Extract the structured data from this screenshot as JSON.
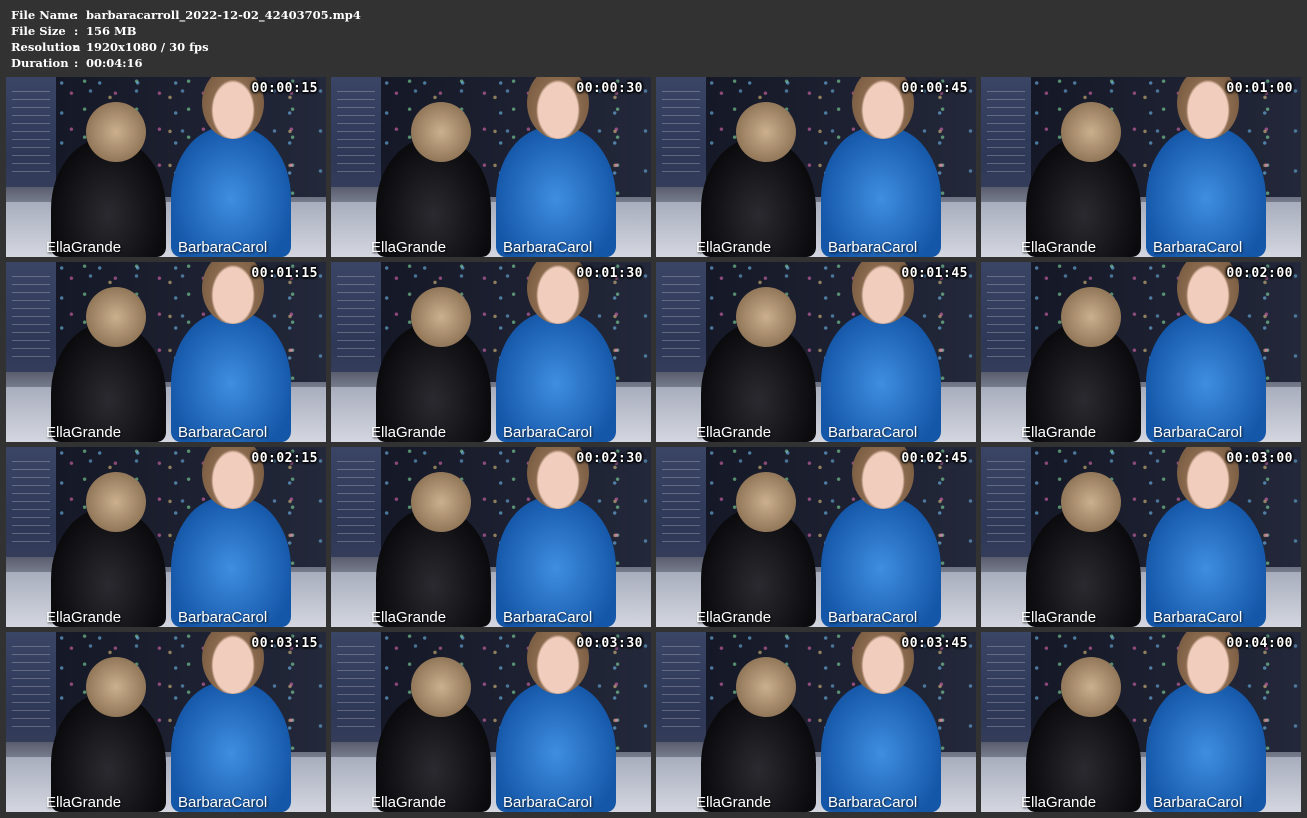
{
  "meta": [
    {
      "key": "File Name",
      "sep": ":",
      "value": "barbaracarroll_2022-12-02_42403705.mp4"
    },
    {
      "key": "File Size",
      "sep": ":",
      "value": "156 MB"
    },
    {
      "key": "Resolution",
      "sep": ":",
      "value": "1920x1080 / 30 fps"
    },
    {
      "key": "Duration",
      "sep": ":",
      "value": "00:04:16"
    }
  ],
  "thumbnails": [
    {
      "timestamp": "00:00:15",
      "left_name": "EllaGrande",
      "right_name": "BarbaraCarol"
    },
    {
      "timestamp": "00:00:30",
      "left_name": "EllaGrande",
      "right_name": "BarbaraCarol"
    },
    {
      "timestamp": "00:00:45",
      "left_name": "EllaGrande",
      "right_name": "BarbaraCarol"
    },
    {
      "timestamp": "00:01:00",
      "left_name": "EllaGrande",
      "right_name": "BarbaraCarol"
    },
    {
      "timestamp": "00:01:15",
      "left_name": "EllaGrande",
      "right_name": "BarbaraCarol"
    },
    {
      "timestamp": "00:01:30",
      "left_name": "EllaGrande",
      "right_name": "BarbaraCarol"
    },
    {
      "timestamp": "00:01:45",
      "left_name": "EllaGrande",
      "right_name": "BarbaraCarol"
    },
    {
      "timestamp": "00:02:00",
      "left_name": "EllaGrande",
      "right_name": "BarbaraCarol"
    },
    {
      "timestamp": "00:02:15",
      "left_name": "EllaGrande",
      "right_name": "BarbaraCarol"
    },
    {
      "timestamp": "00:02:30",
      "left_name": "EllaGrande",
      "right_name": "BarbaraCarol"
    },
    {
      "timestamp": "00:02:45",
      "left_name": "EllaGrande",
      "right_name": "BarbaraCarol"
    },
    {
      "timestamp": "00:03:00",
      "left_name": "EllaGrande",
      "right_name": "BarbaraCarol"
    },
    {
      "timestamp": "00:03:15",
      "left_name": "EllaGrande",
      "right_name": "BarbaraCarol"
    },
    {
      "timestamp": "00:03:30",
      "left_name": "EllaGrande",
      "right_name": "BarbaraCarol"
    },
    {
      "timestamp": "00:03:45",
      "left_name": "EllaGrande",
      "right_name": "BarbaraCarol"
    },
    {
      "timestamp": "00:04:00",
      "left_name": "EllaGrande",
      "right_name": "BarbaraCarol"
    }
  ]
}
